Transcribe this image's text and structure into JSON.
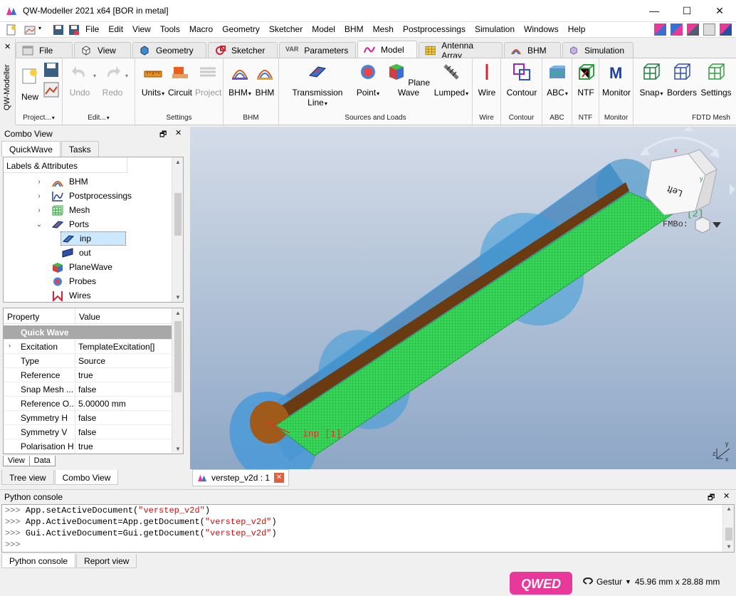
{
  "window": {
    "title": "QW-Modeller 2021 x64 [BOR in metal]",
    "minimize": "—",
    "maximize": "☐",
    "close": "✕"
  },
  "menu": [
    "File",
    "Edit",
    "View",
    "Tools",
    "Macro",
    "Geometry",
    "Sketcher",
    "Model",
    "BHM",
    "Mesh",
    "Postprocessings",
    "Simulation",
    "Windows",
    "Help"
  ],
  "side_strip": {
    "close": "✕",
    "label": "QW-Modeller"
  },
  "ribbon_tabs": [
    {
      "label": "File",
      "icon": "file-icon"
    },
    {
      "label": "View",
      "icon": "cube-icon"
    },
    {
      "label": "Geometry",
      "icon": "geometry-icon"
    },
    {
      "label": "Sketcher",
      "icon": "sketcher-icon"
    },
    {
      "label": "Parameters",
      "icon": "var-icon",
      "icon_text": "VAR"
    },
    {
      "label": "Model",
      "icon": "model-icon",
      "active": true
    },
    {
      "label": "Antenna Array",
      "icon": "antenna-array-icon"
    },
    {
      "label": "BHM",
      "icon": "bhm-icon"
    },
    {
      "label": "Simulation",
      "icon": "simulation-icon"
    }
  ],
  "ribbon": {
    "project": {
      "new": "New",
      "group": "Project..."
    },
    "edit": {
      "undo": "Undo",
      "redo": "Redo",
      "group": "Edit..."
    },
    "settings": {
      "units": "Units",
      "circuit": "Circuit",
      "project": "Project",
      "group": "Settings"
    },
    "bhm": {
      "bhm1": "BHM",
      "bhm2": "BHM",
      "group": "BHM"
    },
    "sources": {
      "tline": "Transmission Line",
      "point": "Point",
      "plane": "Plane Wave",
      "lumped": "Lumped",
      "group": "Sources and Loads"
    },
    "wire": {
      "wire": "Wire",
      "group": "Wire"
    },
    "contour": {
      "contour": "Contour",
      "group": "Contour"
    },
    "abc": {
      "abc": "ABC",
      "group": "ABC"
    },
    "ntf": {
      "ntf": "NTF",
      "group": "NTF"
    },
    "monitor": {
      "monitor": "Monitor",
      "group": "Monitor"
    },
    "fdtd": {
      "snap": "Snap",
      "borders": "Borders",
      "settings": "Settings",
      "group": "FDTD Mesh"
    }
  },
  "combo_view": {
    "title": "Combo View",
    "float": "🗗",
    "close": "✕",
    "tabs": [
      "QuickWave",
      "Tasks"
    ],
    "tree_header": "Labels & Attributes",
    "tree": [
      {
        "label": "BHM",
        "icon": "bhm-icon",
        "arrow": "›"
      },
      {
        "label": "Postprocessings",
        "icon": "postprocessing-icon",
        "arrow": "›"
      },
      {
        "label": "Mesh",
        "icon": "mesh-icon",
        "arrow": "›"
      },
      {
        "label": "Ports",
        "icon": "ports-icon",
        "arrow": "⌄"
      },
      {
        "label": "inp",
        "icon": "port-icon",
        "selected": true
      },
      {
        "label": "out",
        "icon": "port-icon"
      },
      {
        "label": "PlaneWave",
        "icon": "planewave-icon"
      },
      {
        "label": "Probes",
        "icon": "probe-icon"
      },
      {
        "label": "Wires",
        "icon": "wire-icon"
      }
    ],
    "props_header": {
      "property": "Property",
      "value": "Value"
    },
    "props_group": "Quick Wave",
    "props": [
      {
        "k": "Excitation",
        "v": "TemplateExcitation[]",
        "expander": "›"
      },
      {
        "k": "Type",
        "v": "Source"
      },
      {
        "k": "Reference",
        "v": "true"
      },
      {
        "k": "Snap Mesh ...",
        "v": "false"
      },
      {
        "k": "Reference O...",
        "v": "5.00000 mm"
      },
      {
        "k": "Symmetry H",
        "v": "false"
      },
      {
        "k": "Symmetry V",
        "v": "false"
      },
      {
        "k": "Polarisation H",
        "v": "true"
      }
    ],
    "view_data_tabs": [
      "View",
      "Data"
    ],
    "bottom_tabs": [
      "Tree view",
      "Combo View"
    ]
  },
  "viewport": {
    "label_inp": "inp [1]",
    "label_out": "[2]",
    "navcube_face": "Left",
    "fmb_label": "FMBo:",
    "axis_x": "x",
    "axis_y": "y",
    "axis_z": "z"
  },
  "doc_tab": {
    "label": "verstep_v2d : 1",
    "close": "✕"
  },
  "python_console": {
    "title": "Python console",
    "float": "🗗",
    "close": "✕",
    "lines": [
      {
        "prompt": ">>> ",
        "code": "App.setActiveDocument(",
        "str": "\"verstep_v2d\"",
        "tail": ")"
      },
      {
        "prompt": ">>> ",
        "code": "App.ActiveDocument=App.getDocument(",
        "str": "\"verstep_v2d\"",
        "tail": ")"
      },
      {
        "prompt": ">>> ",
        "code": "Gui.ActiveDocument=Gui.getDocument(",
        "str": "\"verstep_v2d\"",
        "tail": ")"
      },
      {
        "prompt": ">>> ",
        "code": "",
        "str": "",
        "tail": ""
      }
    ],
    "tabs": [
      "Python console",
      "Report view"
    ]
  },
  "status": {
    "logo": "QWED",
    "nav_style": "Gestur",
    "dimensions": "45.96 mm x 28.88 mm"
  },
  "colors": {
    "accent_tab": "#fafafa",
    "selection": "#cce8ff",
    "console_string": "#d01010",
    "brand_pink": "#e8389a",
    "mesh_green": "#2ecf50",
    "copper": "#8a4a1a",
    "tube_blue": "#3a8fc8"
  }
}
